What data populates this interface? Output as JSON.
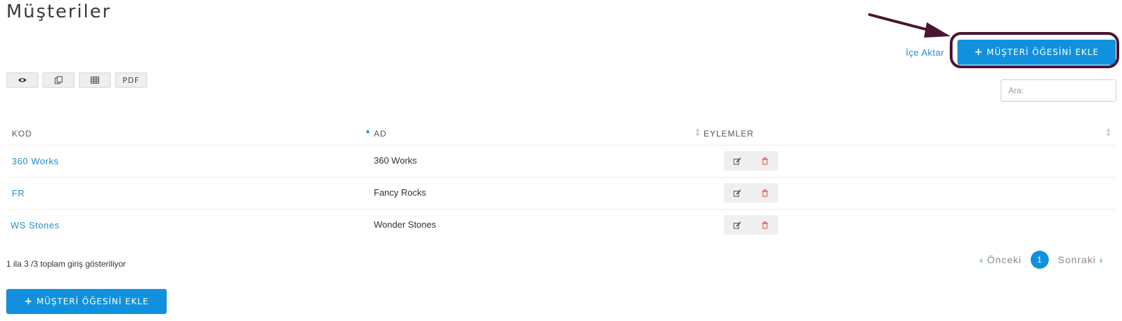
{
  "page": {
    "title": "Müşteriler",
    "import_link": "İçe Aktar",
    "add_button": "MÜŞTERİ ÖĞESİNİ EKLE",
    "search_placeholder": "Ara:"
  },
  "toolbar": {
    "buttons": [
      {
        "name": "view-button",
        "icon": "eye-icon",
        "label": ""
      },
      {
        "name": "copy-button",
        "icon": "copy-icon",
        "label": ""
      },
      {
        "name": "csv-button",
        "icon": "table-icon",
        "label": ""
      },
      {
        "name": "pdf-button",
        "icon": "",
        "label": "PDF"
      }
    ]
  },
  "table": {
    "columns": [
      "KOD",
      "AD",
      "EYLEMLER"
    ],
    "sort": {
      "column": "KOD",
      "direction": "asc"
    },
    "rows": [
      {
        "kod": "360 Works",
        "ad": "360 Works"
      },
      {
        "kod": "FR",
        "ad": "Fancy Rocks"
      },
      {
        "kod": "WS Stones",
        "ad": "Wonder Stones"
      }
    ],
    "row_actions": [
      {
        "name": "edit-icon",
        "color": "#555555"
      },
      {
        "name": "trash-icon",
        "color": "#e05050"
      }
    ]
  },
  "footer": {
    "info": "1 ila 3 /3 toplam giriş gösteriliyor",
    "prev": "Önceki",
    "next": "Sonraki",
    "current_page": "1"
  },
  "colors": {
    "accent": "#1191dd",
    "highlight": "#4a1530"
  }
}
